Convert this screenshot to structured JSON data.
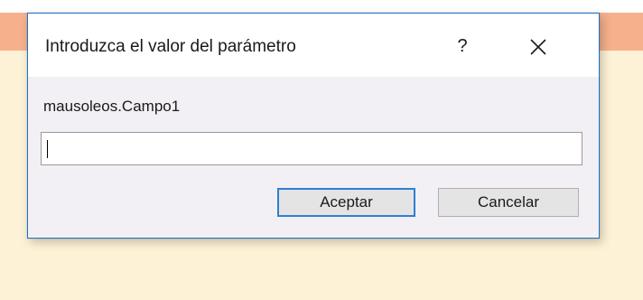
{
  "dialog": {
    "title": "Introduzca el valor del parámetro",
    "help_label": "?",
    "close_icon": "close-icon",
    "prompt": "mausoleos.Campo1",
    "input_value": "",
    "accept_label": "Aceptar",
    "cancel_label": "Cancelar"
  },
  "colors": {
    "background_band": "#f6b08c",
    "background": "#fdf1d6",
    "dialog_border": "#1c73c8",
    "dialog_body": "#f2f0f4",
    "default_button_border": "#2f7fd0"
  }
}
